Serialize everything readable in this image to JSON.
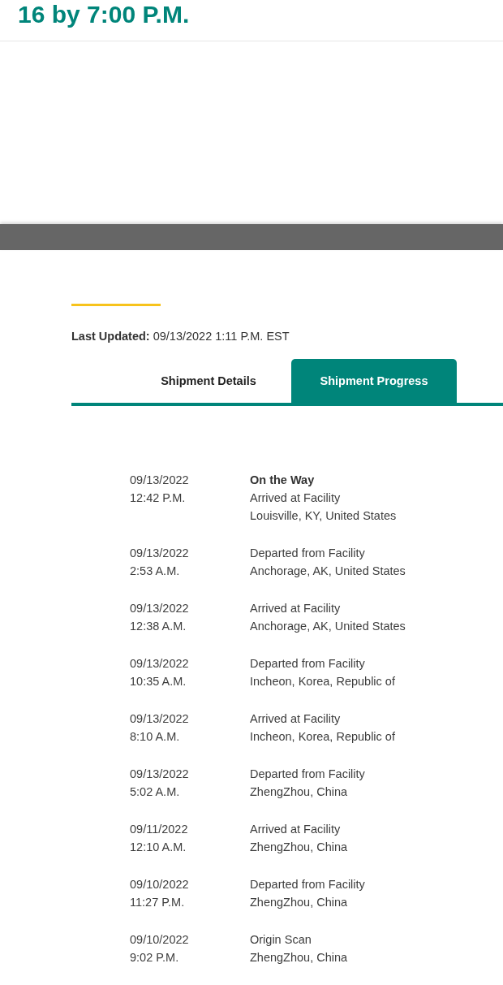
{
  "delivery_heading": "16 by 7:00 P.M.",
  "last_updated": {
    "label": "Last Updated:",
    "value": "09/13/2022 1:11 P.M. EST"
  },
  "tabs": [
    {
      "label": "Shipment Details",
      "selected": false
    },
    {
      "label": "Shipment Progress",
      "selected": true
    }
  ],
  "events": [
    {
      "date": "09/13/2022",
      "time": "12:42 P.M.",
      "status": "On the Way",
      "activity": "Arrived at Facility",
      "location": "Louisville, KY, United States"
    },
    {
      "date": "09/13/2022",
      "time": "2:53 A.M.",
      "activity": "Departed from Facility",
      "location": "Anchorage, AK, United States"
    },
    {
      "date": "09/13/2022",
      "time": "12:38 A.M.",
      "activity": "Arrived at Facility",
      "location": "Anchorage, AK, United States"
    },
    {
      "date": "09/13/2022",
      "time": "10:35 A.M.",
      "activity": "Departed from Facility",
      "location": "Incheon, Korea, Republic of"
    },
    {
      "date": "09/13/2022",
      "time": "8:10 A.M.",
      "activity": "Arrived at Facility",
      "location": "Incheon, Korea, Republic of"
    },
    {
      "date": "09/13/2022",
      "time": "5:02 A.M.",
      "activity": "Departed from Facility",
      "location": "ZhengZhou, China"
    },
    {
      "date": "09/11/2022",
      "time": "12:10 A.M.",
      "activity": "Arrived at Facility",
      "location": "ZhengZhou, China"
    },
    {
      "date": "09/10/2022",
      "time": "11:27 P.M.",
      "activity": "Departed from Facility",
      "location": "ZhengZhou, China"
    },
    {
      "date": "09/10/2022",
      "time": "9:02 P.M.",
      "activity": "Origin Scan",
      "location": "ZhengZhou, China"
    }
  ]
}
